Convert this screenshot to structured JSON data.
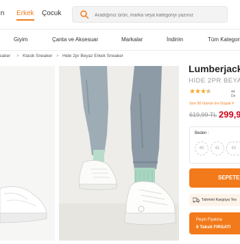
{
  "gender_tabs": [
    {
      "label": "ın"
    },
    {
      "label": "Erkek",
      "active": true
    },
    {
      "label": "Çocuk"
    }
  ],
  "search": {
    "placeholder": "Aradığınız ürün, marka veya kategoriyi yazınız"
  },
  "categories": [
    "Giyim",
    "Çanta ve Aksesuar",
    "Markalar",
    "İndirim",
    "Tüm Kategori"
  ],
  "breadcrumbs": [
    "eaker",
    "Klasik Sneaker",
    "Hide 2pr Beyaz Erkek Sneaker"
  ],
  "breadcrumb_sep": ">",
  "product": {
    "brand": "Lumberjack",
    "name": "HIDE 2PR BEYA",
    "rating_stars": 3.5,
    "rating_text": "44 De",
    "lowest_price_note": "Son 30 Günün En Düşük F",
    "old_price": "619,99 TL",
    "new_price": "299,9",
    "size_label": "Beden :",
    "sizes": [
      "40",
      "41",
      "42"
    ],
    "add_to_cart": "SEPETE",
    "shipping_text": "Tahmini Kargoya Tes",
    "promo_line1": "Peşin Fiyatına",
    "promo_line2": "6 Taksit FIRSATI"
  },
  "colors": {
    "accent": "#f27a1a",
    "price": "#d0021b",
    "star": "#f9a825"
  }
}
